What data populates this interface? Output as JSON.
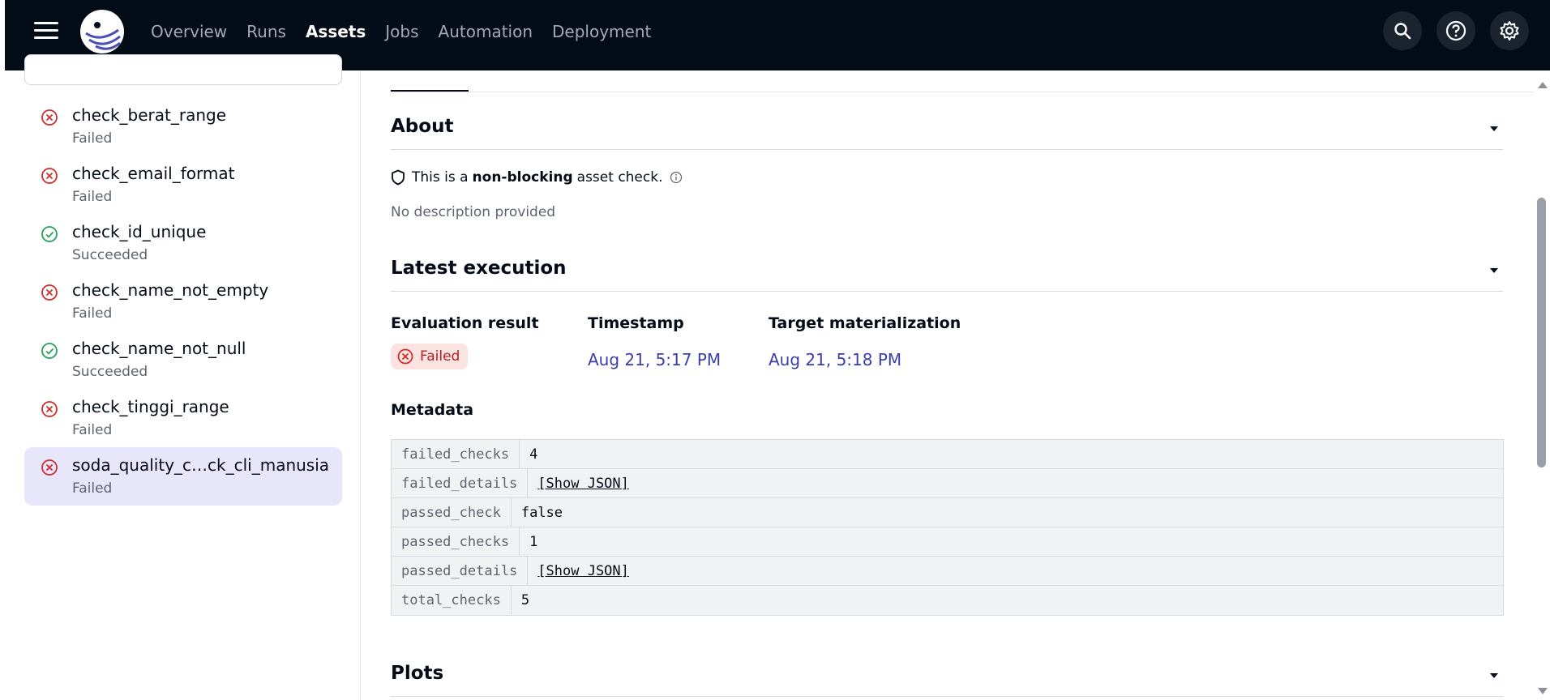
{
  "nav": {
    "items": [
      {
        "label": "Overview",
        "active": false
      },
      {
        "label": "Runs",
        "active": false
      },
      {
        "label": "Assets",
        "active": true
      },
      {
        "label": "Jobs",
        "active": false
      },
      {
        "label": "Automation",
        "active": false
      },
      {
        "label": "Deployment",
        "active": false
      }
    ],
    "icons": [
      "search-icon",
      "help-icon",
      "settings-gear-icon"
    ]
  },
  "sidebar": {
    "checks": [
      {
        "name": "check_berat_range",
        "status": "Failed",
        "state": "failed"
      },
      {
        "name": "check_email_format",
        "status": "Failed",
        "state": "failed"
      },
      {
        "name": "check_id_unique",
        "status": "Succeeded",
        "state": "succeeded"
      },
      {
        "name": "check_name_not_empty",
        "status": "Failed",
        "state": "failed"
      },
      {
        "name": "check_name_not_null",
        "status": "Succeeded",
        "state": "succeeded"
      },
      {
        "name": "check_tinggi_range",
        "status": "Failed",
        "state": "failed"
      },
      {
        "name": "soda_quality_c…ck_cli_manusia",
        "status": "Failed",
        "state": "failed",
        "selected": true
      }
    ]
  },
  "about": {
    "title": "About",
    "nonblocking_prefix": "This is a",
    "nonblocking_bold": "non-blocking",
    "nonblocking_suffix": "asset check.",
    "description": "No description provided"
  },
  "latest_execution": {
    "title": "Latest execution",
    "evaluation_label": "Evaluation result",
    "evaluation_value": "Failed",
    "timestamp_label": "Timestamp",
    "timestamp_value": "Aug 21, 5:17 PM",
    "target_label": "Target materialization",
    "target_value": "Aug 21, 5:18 PM"
  },
  "metadata": {
    "title": "Metadata",
    "rows": [
      {
        "key": "failed_checks",
        "value": "4",
        "link": false
      },
      {
        "key": "failed_details",
        "value": "[Show JSON]",
        "link": true
      },
      {
        "key": "passed_check",
        "value": "false",
        "link": false
      },
      {
        "key": "passed_checks",
        "value": "1",
        "link": false
      },
      {
        "key": "passed_details",
        "value": "[Show JSON]",
        "link": true
      },
      {
        "key": "total_checks",
        "value": "5",
        "link": false
      }
    ]
  },
  "plots": {
    "title": "Plots"
  },
  "colors": {
    "topbar": "#030c17",
    "failed": "#d12b2b",
    "succeeded": "#22a35a",
    "link": "#3b3ea8",
    "selected_bg": "#e8e6fb"
  }
}
